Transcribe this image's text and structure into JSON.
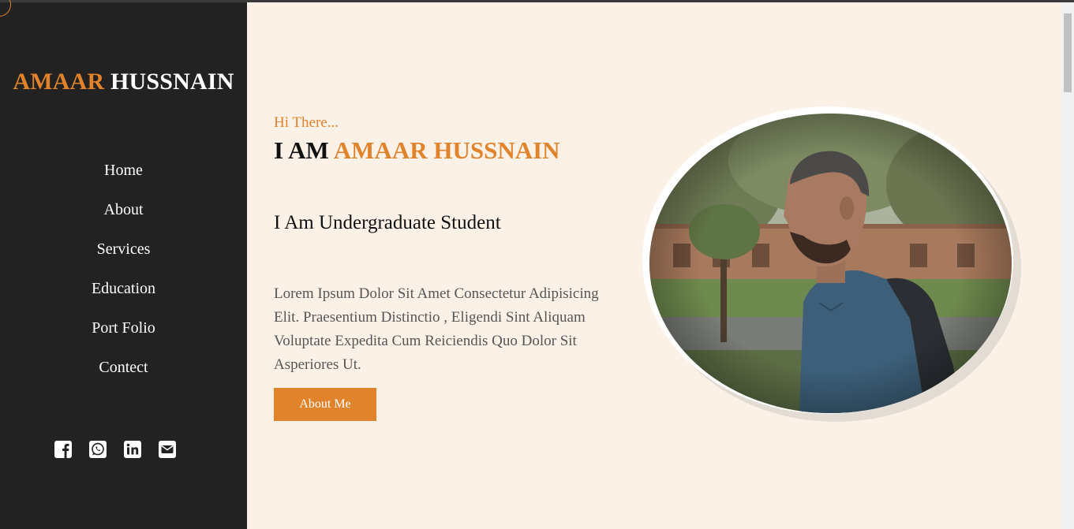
{
  "sidebar": {
    "brand_first": "AMAAR",
    "brand_last": "HUSSNAIN",
    "nav": [
      "Home",
      "About",
      "Services",
      "Education",
      "Port Folio",
      "Contect"
    ],
    "social_icons": [
      "facebook-icon",
      "whatsapp-icon",
      "linkedin-icon",
      "mail-icon"
    ]
  },
  "hero": {
    "greeting": "Hi There...",
    "headline_prefix": "I AM",
    "headline_name": "AMAAR HUSSNAIN",
    "role": "I Am Undergraduate Student",
    "description": "Lorem Ipsum Dolor Sit Amet Consectetur Adipisicing Elit. Praesentium Distinctio , Eligendi Sint Aliquam Voluptate Expedita Cum Reiciendis Quo Dolor Sit Asperiores Ut.",
    "button_label": "About Me"
  },
  "colors": {
    "accent": "#e0832a",
    "sidebar_bg": "#222222",
    "page_bg": "#fcf1e6"
  }
}
